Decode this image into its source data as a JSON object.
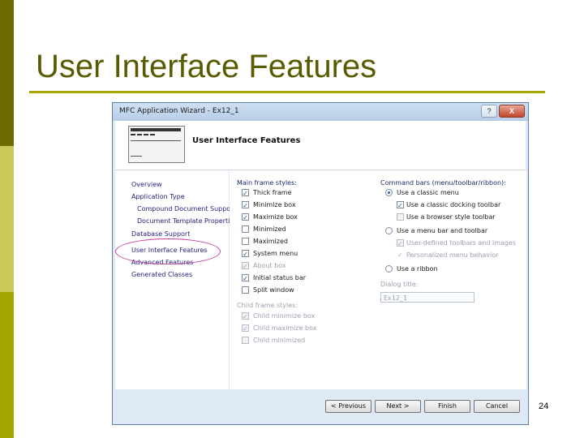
{
  "slide": {
    "title": "User Interface Features",
    "page_number": "24",
    "colors": {
      "accent": "#a6a600",
      "title": "#5a5a00"
    }
  },
  "dialog": {
    "window_title": "MFC Application Wizard - Ex12_1",
    "help_button": "?",
    "close_button": "X",
    "header_title": "User Interface Features",
    "nav_items": [
      "Overview",
      "Application Type",
      "Compound Document Support",
      "Document Template Properties",
      "Database Support",
      "User Interface Features",
      "Advanced Features",
      "Generated Classes"
    ],
    "main_frame_styles": {
      "label": "Main frame styles:",
      "options": [
        {
          "label": "Thick frame",
          "checked": true
        },
        {
          "label": "Minimize box",
          "checked": true
        },
        {
          "label": "Maximize box",
          "checked": true
        },
        {
          "label": "Minimized",
          "checked": false
        },
        {
          "label": "Maximized",
          "checked": false
        },
        {
          "label": "System menu",
          "checked": true
        },
        {
          "label": "About box",
          "checked": true,
          "disabled": true
        },
        {
          "label": "Initial status bar",
          "checked": true
        },
        {
          "label": "Split window",
          "checked": false
        }
      ]
    },
    "child_frame_styles": {
      "label": "Child frame styles:",
      "options": [
        {
          "label": "Child minimize box",
          "checked": true
        },
        {
          "label": "Child maximize box",
          "checked": true
        },
        {
          "label": "Child minimized",
          "checked": false
        }
      ]
    },
    "command_bars": {
      "label": "Command bars (menu/toolbar/ribbon):",
      "radio_classic": "Use a classic menu",
      "classic_docking_toolbar": "Use a classic docking toolbar",
      "browser_style_toolbar": "Use a browser style toolbar",
      "radio_menu_toolbar": "Use a menu bar and toolbar",
      "user_defined_toolbars": "User-defined toolbars and images",
      "personalized_menu": "Personalized menu behavior",
      "radio_ribbon": "Use a ribbon"
    },
    "dialog_title": {
      "label": "Dialog title:",
      "value": "Ex12_1"
    },
    "buttons": {
      "previous": "< Previous",
      "next": "Next >",
      "finish": "Finish",
      "cancel": "Cancel"
    }
  }
}
